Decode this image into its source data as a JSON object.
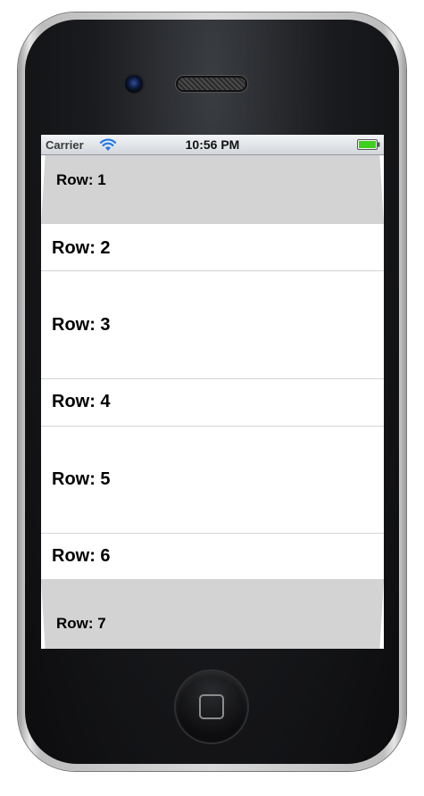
{
  "status_bar": {
    "carrier": "Carrier",
    "time": "10:56 PM",
    "wifi_icon": "wifi-icon",
    "battery_icon": "battery-full-icon",
    "battery_color": "#3fcf1e"
  },
  "table": {
    "rows": [
      {
        "label": "Row: 1"
      },
      {
        "label": "Row: 2"
      },
      {
        "label": "Row: 3"
      },
      {
        "label": "Row: 4"
      },
      {
        "label": "Row: 5"
      },
      {
        "label": "Row: 6"
      },
      {
        "label": "Row: 7"
      }
    ]
  },
  "device": {
    "home_button_icon": "home-square-icon"
  }
}
